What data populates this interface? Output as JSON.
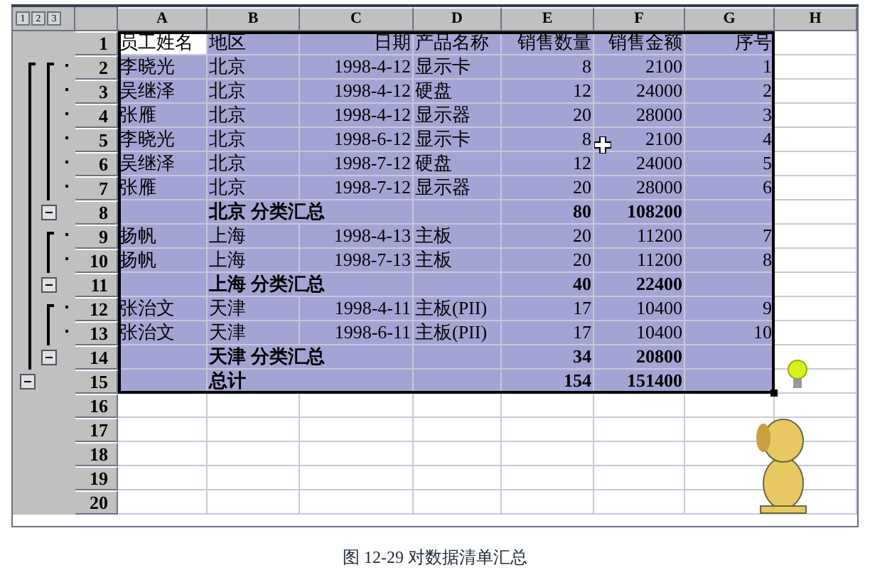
{
  "outline_levels": [
    "1",
    "2",
    "3"
  ],
  "column_headers": [
    "A",
    "B",
    "C",
    "D",
    "E",
    "F",
    "G",
    "H"
  ],
  "rows": [
    {
      "number": "1",
      "kind": "header",
      "selected": true,
      "first_cell_active": true,
      "cells": {
        "A": "员工姓名",
        "B": "地区",
        "C": "日期",
        "D": "产品名称",
        "E": "销售数量",
        "F": "销售金额",
        "G": "序号"
      }
    },
    {
      "number": "2",
      "kind": "detail",
      "selected": true,
      "cells": {
        "A": "李晓光",
        "B": "北京",
        "C": "1998-4-12",
        "D": "显示卡",
        "E": "8",
        "F": "2100",
        "G": "1"
      }
    },
    {
      "number": "3",
      "kind": "detail",
      "selected": true,
      "cells": {
        "A": "吴继泽",
        "B": "北京",
        "C": "1998-4-12",
        "D": "硬盘",
        "E": "12",
        "F": "24000",
        "G": "2"
      }
    },
    {
      "number": "4",
      "kind": "detail",
      "selected": true,
      "cells": {
        "A": "张雁",
        "B": "北京",
        "C": "1998-4-12",
        "D": "显示器",
        "E": "20",
        "F": "28000",
        "G": "3"
      }
    },
    {
      "number": "5",
      "kind": "detail",
      "selected": true,
      "cells": {
        "A": "李晓光",
        "B": "北京",
        "C": "1998-6-12",
        "D": "显示卡",
        "E": "8",
        "F": "2100",
        "G": "4"
      }
    },
    {
      "number": "6",
      "kind": "detail",
      "selected": true,
      "cells": {
        "A": "吴继泽",
        "B": "北京",
        "C": "1998-7-12",
        "D": "硬盘",
        "E": "12",
        "F": "24000",
        "G": "5"
      }
    },
    {
      "number": "7",
      "kind": "detail",
      "selected": true,
      "cells": {
        "A": "张雁",
        "B": "北京",
        "C": "1998-7-12",
        "D": "显示器",
        "E": "20",
        "F": "28000",
        "G": "6"
      }
    },
    {
      "number": "8",
      "kind": "subtotal",
      "selected": true,
      "cells": {
        "B": "北京  分类汇总",
        "E": "80",
        "F": "108200"
      }
    },
    {
      "number": "9",
      "kind": "detail",
      "selected": true,
      "cells": {
        "A": "扬帆",
        "B": "上海",
        "C": "1998-4-13",
        "D": "主板",
        "E": "20",
        "F": "11200",
        "G": "7"
      }
    },
    {
      "number": "10",
      "kind": "detail",
      "selected": true,
      "cells": {
        "A": "扬帆",
        "B": "上海",
        "C": "1998-7-13",
        "D": "主板",
        "E": "20",
        "F": "11200",
        "G": "8"
      }
    },
    {
      "number": "11",
      "kind": "subtotal",
      "selected": true,
      "cells": {
        "B": "上海  分类汇总",
        "E": "40",
        "F": "22400"
      }
    },
    {
      "number": "12",
      "kind": "detail",
      "selected": true,
      "cells": {
        "A": "张治文",
        "B": "天津",
        "C": "1998-4-11",
        "D": "主板(PII)",
        "E": "17",
        "F": "10400",
        "G": "9"
      }
    },
    {
      "number": "13",
      "kind": "detail",
      "selected": true,
      "cells": {
        "A": "张治文",
        "B": "天津",
        "C": "1998-6-11",
        "D": "主板(PII)",
        "E": "17",
        "F": "10400",
        "G": "10"
      }
    },
    {
      "number": "14",
      "kind": "subtotal",
      "selected": true,
      "cells": {
        "B": "天津  分类汇总",
        "E": "34",
        "F": "20800"
      }
    },
    {
      "number": "15",
      "kind": "total",
      "selected": true,
      "cells": {
        "B": "总计",
        "E": "154",
        "F": "151400"
      }
    },
    {
      "number": "16",
      "kind": "empty",
      "selected": false,
      "cells": {}
    },
    {
      "number": "17",
      "kind": "empty",
      "selected": false,
      "cells": {}
    },
    {
      "number": "18",
      "kind": "empty",
      "selected": false,
      "cells": {}
    },
    {
      "number": "19",
      "kind": "empty",
      "selected": false,
      "cells": {}
    },
    {
      "number": "20",
      "kind": "empty",
      "selected": false,
      "cells": {}
    }
  ],
  "caption": "图 12-29  对数据清单汇总"
}
